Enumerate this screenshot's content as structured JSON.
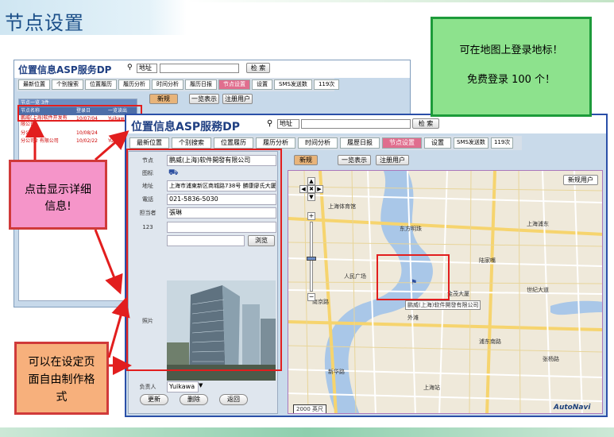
{
  "slide": {
    "title": "节点设置"
  },
  "notes": {
    "green": {
      "line1": "可在地图上登录地标！",
      "line2": "免费登录 100 个！"
    },
    "pink": {
      "line1": "点击显示详细",
      "line2": "信息!"
    },
    "orange": {
      "line1": "可以在设定页",
      "line2": "面自由制作格",
      "line3": "式"
    }
  },
  "back_app": {
    "logo": "位置信息ASP服务DP",
    "search_select": "地址",
    "search_button": "检 索",
    "tabs": [
      "最新位置",
      "个别搜索",
      "位置履历",
      "履历分析",
      "时间分析",
      "履历日报",
      "节点设置",
      "设置"
    ],
    "sms_label": "SMS发送数",
    "sms_count": "119次",
    "btn_new": "新规",
    "btn_list": "一览表示",
    "btn_reg": "注册用户",
    "list_title": "节点一览 3件",
    "list_headers": [
      "节点名称",
      "登录日",
      "一览读出"
    ],
    "list_rows": [
      [
        "鹏威(上海)软件开发有限公司",
        "10/07/04",
        "Yuikawa"
      ],
      [
        "分公司",
        "10/08/24",
        ""
      ],
      [
        "分公司2 有限公司",
        "10/02/22",
        "Yuikawa"
      ]
    ]
  },
  "front_app": {
    "logo": "位置信息ASP服務DP",
    "search_select": "地址",
    "search_button": "检 索",
    "tabs": [
      "最新位置",
      "个别搜索",
      "位置履历",
      "履历分析",
      "时间分析",
      "履歷日报",
      "节点设置",
      "设置"
    ],
    "active_tab": "节点设置",
    "sms_label": "SMS发送数",
    "sms_count": "119次",
    "btn_new": "新规",
    "btn_list": "一览表示",
    "btn_reg": "注册用户",
    "map_new_button": "新规用户",
    "detail": {
      "node_label": "节点",
      "node_value": "鹏威(上海)软件開發有限公司",
      "icon_label": "图标",
      "address_label": "地址",
      "address_value": "上海市浦東新区商城路738号 勝康廖氏大厦",
      "phone_label": "電話",
      "phone_value": "021-5836-5030",
      "contact_label": "担当者",
      "contact_value": "張琳",
      "field123_label": "123",
      "field123_value": "",
      "browse_button": "浏览",
      "photo_label": "照片",
      "owner_label": "负责人",
      "owner_value": "Yuikawa",
      "btn_update": "更新",
      "btn_delete": "删除",
      "btn_back": "返回"
    },
    "map": {
      "highlight_label": "鹏威(上海)软件開發有限公司",
      "scale": "2000 英尺",
      "brand": "AutoNavi",
      "places": [
        "上海体育馆",
        "上海浦东",
        "东方明珠",
        "人民广场",
        "陆家嘴",
        "世纪大道",
        "南京路",
        "外滩",
        "浦东南路",
        "张杨路",
        "金茂大厦",
        "新华路",
        "上海站"
      ]
    }
  }
}
